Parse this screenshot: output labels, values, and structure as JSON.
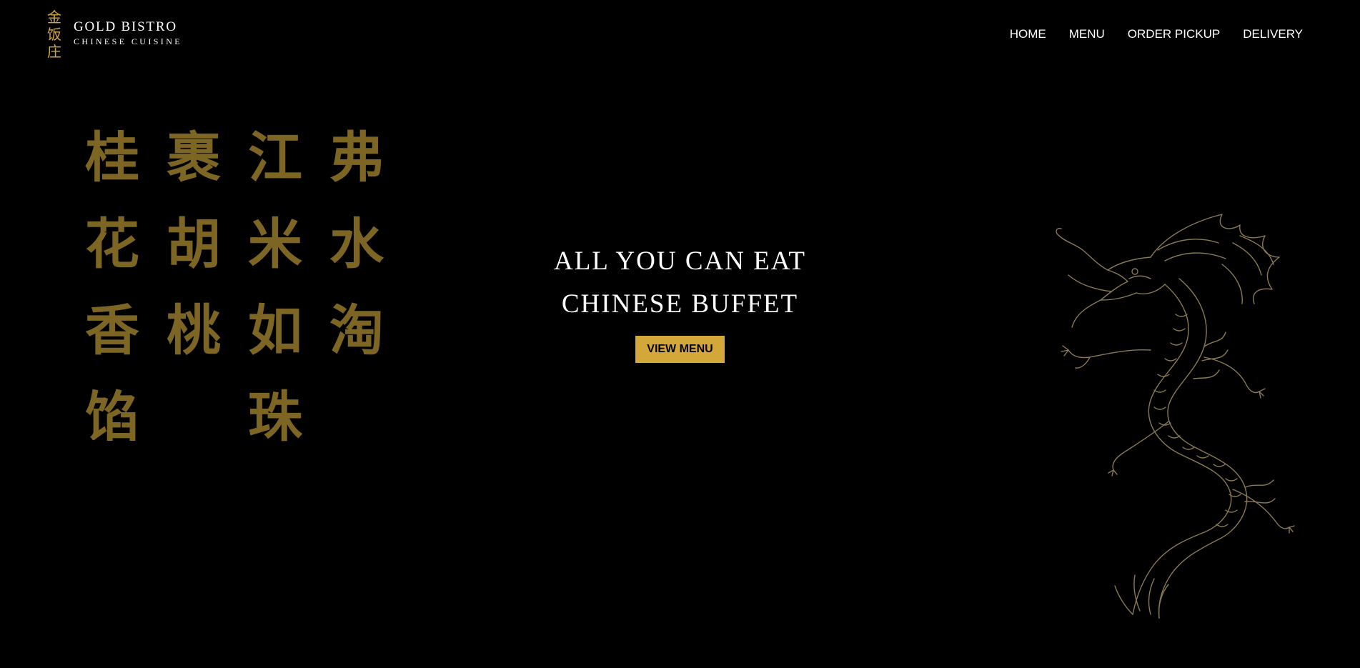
{
  "header": {
    "logo_chars": [
      "金",
      "饭",
      "庄"
    ],
    "brand_name": "GOLD BISTRO",
    "brand_sub": "CHINESE CUISINE",
    "nav": [
      {
        "label": "HOME"
      },
      {
        "label": "MENU"
      },
      {
        "label": "ORDER PICKUP"
      },
      {
        "label": "DELIVERY"
      }
    ]
  },
  "calligraphy": {
    "columns": [
      [
        "桂",
        "花",
        "香",
        "馅"
      ],
      [
        "裹",
        "胡",
        "桃",
        ""
      ],
      [
        "江",
        "米",
        "如",
        "珠"
      ],
      [
        "弗",
        "水",
        "淘",
        ""
      ]
    ]
  },
  "hero": {
    "line1": "ALL YOU CAN EAT",
    "line2": "CHINESE BUFFET",
    "cta_label": "VIEW MENU"
  },
  "colors": {
    "background": "#000000",
    "gold": "#d4a73a",
    "calligraphy": "#7d6523",
    "dragon_line": "#8a7a55"
  },
  "icons": {
    "dragon": "dragon-illustration"
  }
}
